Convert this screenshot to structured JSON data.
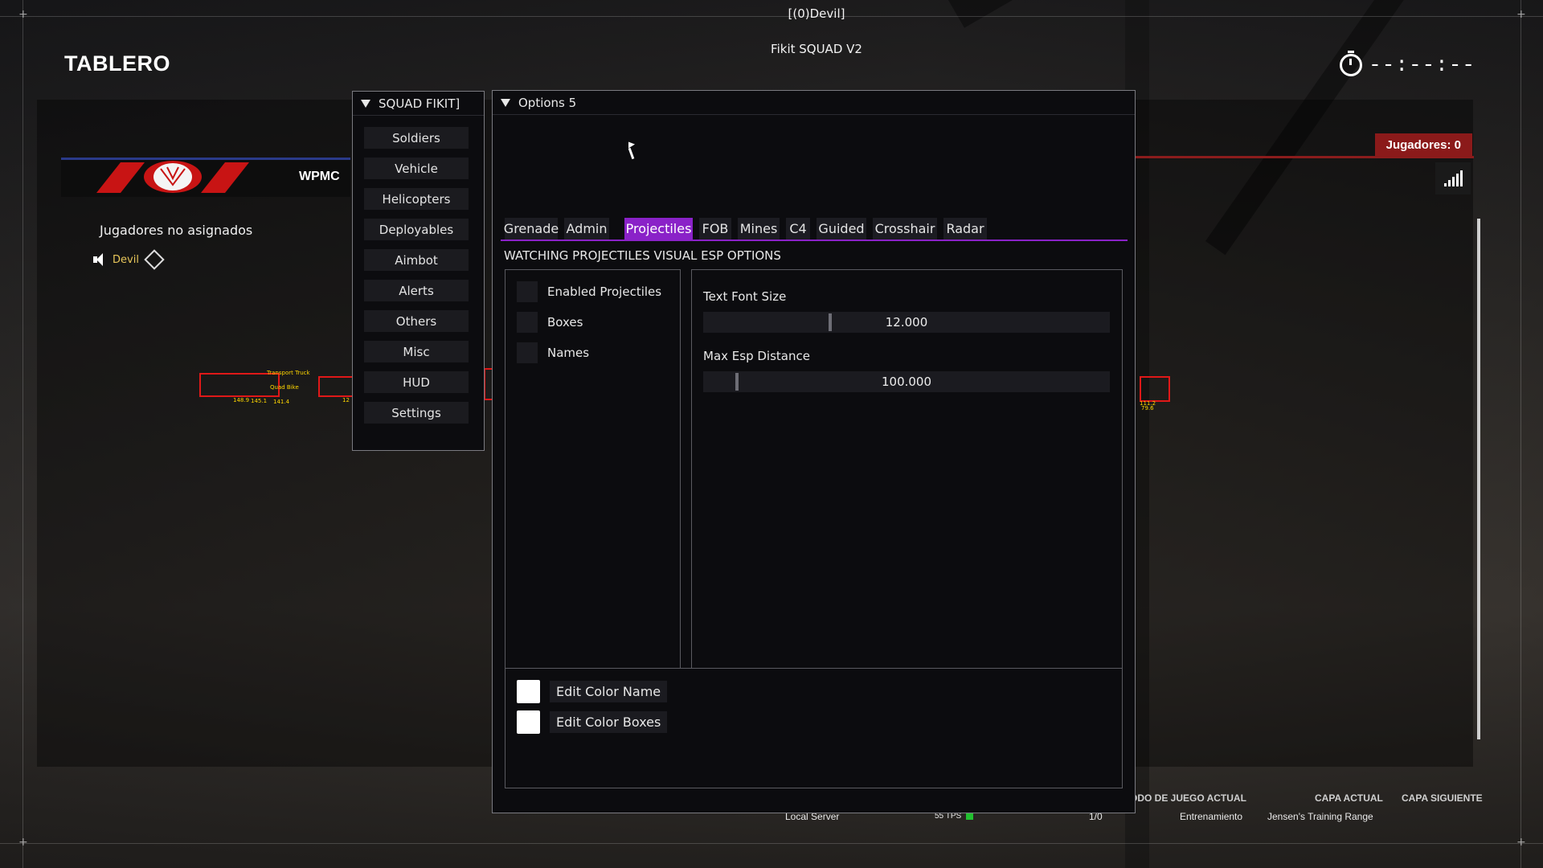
{
  "window_title": "[(0)Devil]",
  "subtitle": "Fikit SQUAD V2",
  "scoreboard": {
    "title": "TABLERO",
    "timer": "--:--:--",
    "players_badge": "Jugadores: 0",
    "team_name": "WPMC",
    "unassigned_header": "Jugadores no asignados",
    "player_name": "Devil"
  },
  "status_bar": {
    "game_mode_label": "ODO DE JUEGO ACTUAL",
    "current_layer_label": "CAPA ACTUAL",
    "next_layer_label": "CAPA SIGUIENTE",
    "server": "Local Server",
    "tps": "55 TPS",
    "players": "1/0",
    "game_mode": "Entrenamiento",
    "current_layer": "Jensen's Training Range"
  },
  "esp_labels": {
    "vehicle_a": "Transport Truck",
    "vehicle_b": "Quad Bike",
    "dist_a": "148.9",
    "dist_b": "145.1",
    "dist_c": "141.4",
    "dist_d": "12",
    "dist_e": "111.2",
    "dist_f": "79.6"
  },
  "left_menu": {
    "title": "SQUAD FIKIT]",
    "items": [
      "Soldiers",
      "Vehicle",
      "Helicopters",
      "Deployables",
      "Aimbot",
      "Alerts",
      "Others",
      "Misc",
      "HUD",
      "Settings"
    ]
  },
  "options": {
    "title": "Options 5",
    "tabs": [
      "Grenade",
      "Admin",
      "Projectiles",
      "FOB",
      "Mines",
      "C4",
      "Guided",
      "Crosshair",
      "Radar"
    ],
    "active_tab": "Projectiles",
    "section_header": "WATCHING PROJECTILES VISUAL ESP OPTIONS",
    "checkboxes": [
      {
        "label": "Enabled Projectiles",
        "checked": false
      },
      {
        "label": "Boxes",
        "checked": false
      },
      {
        "label": "Names",
        "checked": false
      }
    ],
    "sliders": [
      {
        "label": "Text Font Size",
        "value": "12.000",
        "fraction": 0.31
      },
      {
        "label": "Max Esp Distance",
        "value": "100.000",
        "fraction": 0.08
      }
    ],
    "color_buttons": [
      {
        "label": "Edit Color Name",
        "swatch": "#ffffff"
      },
      {
        "label": "Edit Color Boxes",
        "swatch": "#ffffff"
      }
    ]
  },
  "colors": {
    "accent": "#8a22c8",
    "esp_box": "#e01818",
    "badge": "#8b1a1a",
    "tps_indicator": "#22c030"
  }
}
